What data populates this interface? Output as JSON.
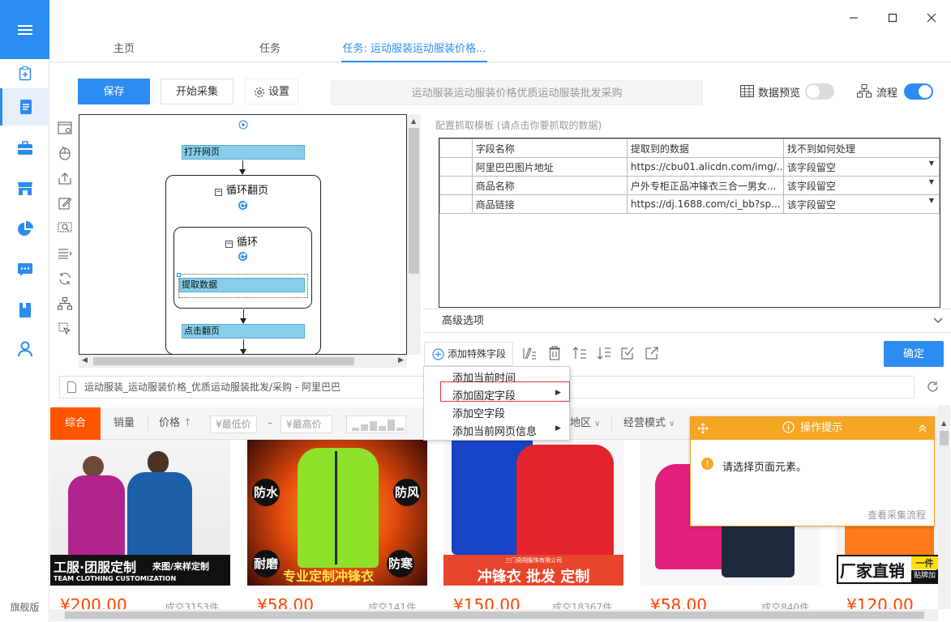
{
  "sidebar": {
    "bottom_label": "旗舰版"
  },
  "tabs": [
    {
      "label": "主页"
    },
    {
      "label": "任务"
    },
    {
      "label": "任务: 运动服装运动服装价格..."
    }
  ],
  "toolbar": {
    "save_label": "保存",
    "start_label": "开始采集",
    "settings_label": "设置",
    "url_text": "运动服装运动服装价格优质运动服装批发采购",
    "data_preview_label": "数据预览",
    "flow_label": "流程",
    "data_preview_on": false,
    "flow_on": true
  },
  "flow": {
    "open_page": "打开网页",
    "loop_paging": "循环翻页",
    "loop": "循环",
    "extract": "提取数据",
    "click_next": "点击翻页"
  },
  "config": {
    "title": "配置抓取模板 (请点击你要抓取的数据)",
    "columns": [
      "字段名称",
      "提取到的数据",
      "找不到如何处理"
    ],
    "rows": [
      {
        "name": "阿里巴巴图片地址",
        "value": "https://cbu01.alicdn.com/img/...",
        "handle": "该字段留空"
      },
      {
        "name": "商品名称",
        "value": "户外专柜正品冲锋衣三合一男女...",
        "handle": "该字段留空"
      },
      {
        "name": "商品链接",
        "value": "https://dj.1688.com/ci_bb?sp...",
        "handle": "该字段留空"
      }
    ],
    "advanced": "高级选项",
    "add_special": "添加特殊字段",
    "confirm": "确定"
  },
  "context_menu": {
    "items": [
      "添加当前时间",
      "添加固定字段",
      "添加空字段",
      "添加当前网页信息"
    ]
  },
  "browser": {
    "path": "运动服装_运动服装价格_优质运动服装批发/采购 - 阿里巴巴",
    "sort": {
      "all": "综合",
      "sales": "销量",
      "price": "价格",
      "min_price": "¥最低价",
      "dash": "–",
      "max_price": "¥最高价",
      "region": "地区",
      "mode": "经营模式"
    },
    "products": [
      {
        "price": "¥200.00",
        "sold": "成交3153件",
        "banner": "工服·团服定制",
        "banner_sub": "来图/来样定制",
        "banner_en": "TEAM CLOTHING CUSTOMIZATION"
      },
      {
        "price": "¥58.00",
        "sold": "成交141件",
        "tag1": "防水",
        "tag2": "防风",
        "tag3": "耐磨",
        "tag4": "防寒",
        "banner": "专业定制冲锋衣"
      },
      {
        "price": "¥150.00",
        "sold": "成交18367件",
        "banner_top": "三门奇翔服饰有限公司",
        "banner": "冲锋衣 批发 定制"
      },
      {
        "price": "¥58.00",
        "sold": "成交840件"
      },
      {
        "price": "¥120.00",
        "banner": "厂家直销",
        "banner_side": "一件",
        "banner_side2": "贴牌加"
      }
    ],
    "tip": {
      "title": "操作提示",
      "message": "请选择页面元素。",
      "link": "查看采集流程"
    }
  }
}
